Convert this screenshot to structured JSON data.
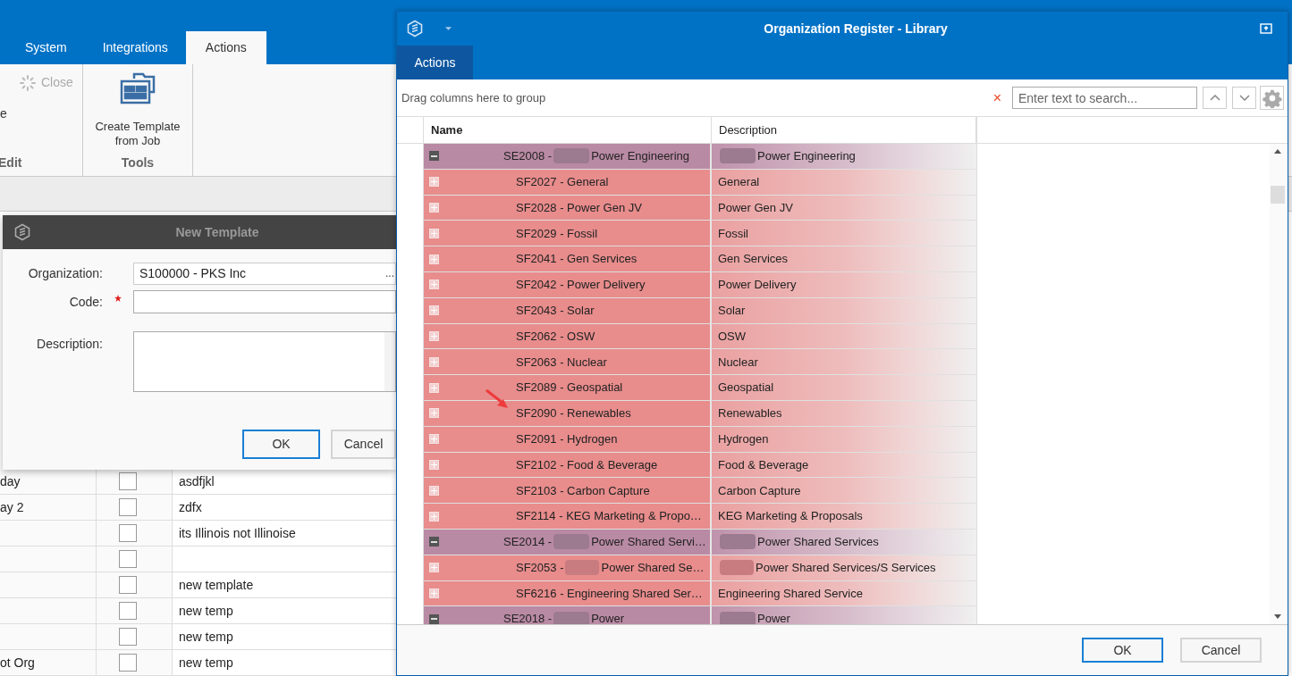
{
  "main_window": {
    "tabs": [
      {
        "label": "System",
        "selected": false
      },
      {
        "label": "Integrations",
        "selected": false
      },
      {
        "label": "Actions",
        "selected": true
      }
    ],
    "ribbon": {
      "groups": [
        {
          "label": "Edit",
          "partial_label": "e",
          "buttons": [
            {
              "label": "Close",
              "disabled": true
            }
          ]
        },
        {
          "label": "Tools",
          "buttons": [
            {
              "label": "Create Template from Job",
              "disabled": false
            }
          ]
        }
      ]
    },
    "grid": {
      "rows": [
        {
          "column_1": "day",
          "checked": false,
          "column_3": "asdfjkl"
        },
        {
          "column_1": "ay 2",
          "checked": false,
          "column_3": "zdfx"
        },
        {
          "checked": false,
          "column_3": "its Illinois not Illinoise"
        },
        {
          "checked": false
        },
        {
          "checked": false,
          "column_3": "new template"
        },
        {
          "checked": false,
          "column_3": "new temp"
        },
        {
          "checked": false,
          "column_3": "new temp"
        },
        {
          "column_1": "ot Org",
          "checked": false,
          "column_3": "new temp"
        }
      ]
    }
  },
  "new_template_dialog": {
    "title": "New Template",
    "organization": {
      "label": "Organization:",
      "value": "S100000 - PKS Inc",
      "ellipsis": "..."
    },
    "code": {
      "label": "Code:",
      "required": true
    },
    "description": {
      "label": "Description:"
    },
    "buttons": [
      {
        "label": "OK",
        "default": true
      },
      {
        "label": "Cancel",
        "default": false
      }
    ]
  },
  "library_dialog": {
    "title": "Organization Register - Library",
    "tab": "Actions",
    "group_hint": "Drag columns here to group",
    "clear_mark": "×",
    "search_placeholder": "Enter text to search...",
    "columns": [
      "Name",
      "Description"
    ],
    "rows": [
      {
        "kind": "group",
        "code": "SE2008 -",
        "name": "Power Engineering",
        "description": "Power Engineering",
        "redacted": true,
        "expanded": true,
        "children": [
          {
            "kind": "item",
            "code": "SF2027 -",
            "name": "General",
            "description": "General",
            "redacted": false,
            "expanded": false
          },
          {
            "kind": "item",
            "code": "SF2028 -",
            "name": "Power Gen JV",
            "description": "Power Gen JV",
            "redacted": false,
            "expanded": false
          },
          {
            "kind": "item",
            "code": "SF2029 -",
            "name": "Fossil",
            "description": "Fossil",
            "redacted": false,
            "expanded": false
          },
          {
            "kind": "item",
            "code": "SF2041 -",
            "name": "Gen Services",
            "description": "Gen Services",
            "redacted": false,
            "expanded": false
          },
          {
            "kind": "item",
            "code": "SF2042 -",
            "name": "Power Delivery",
            "description": "Power Delivery",
            "redacted": false,
            "expanded": false
          },
          {
            "kind": "item",
            "code": "SF2043 -",
            "name": "Solar",
            "description": "Solar",
            "redacted": false,
            "expanded": false
          },
          {
            "kind": "item",
            "code": "SF2062 -",
            "name": "OSW",
            "description": "OSW",
            "redacted": false,
            "expanded": false
          },
          {
            "kind": "item",
            "code": "SF2063 -",
            "name": "Nuclear",
            "description": "Nuclear",
            "redacted": false,
            "expanded": false
          },
          {
            "kind": "item",
            "code": "SF2089 -",
            "name": "Geospatial",
            "description": "Geospatial",
            "redacted": false,
            "expanded": false
          },
          {
            "kind": "item",
            "code": "SF2090 -",
            "name": "Renewables",
            "description": "Renewables",
            "redacted": false,
            "expanded": false
          },
          {
            "kind": "item",
            "code": "SF2091 -",
            "name": "Hydrogen",
            "description": "Hydrogen",
            "redacted": false,
            "expanded": false
          },
          {
            "kind": "item",
            "code": "SF2102 -",
            "name": "Food & Beverage",
            "description": "Food & Beverage",
            "redacted": false,
            "expanded": false
          },
          {
            "kind": "item",
            "code": "SF2103 -",
            "name": "Carbon Capture",
            "description": "Carbon Capture",
            "redacted": false,
            "expanded": false
          },
          {
            "kind": "item",
            "code": "SF2114 -",
            "name": "KEG Marketing & Propo…",
            "description": "KEG Marketing & Proposals",
            "redacted": false,
            "expanded": false
          }
        ]
      },
      {
        "kind": "group",
        "code": "SE2014 -",
        "name": "Power Shared Servi…",
        "description": "Power Shared Services",
        "redacted": true,
        "expanded": true,
        "children": [
          {
            "kind": "item",
            "code": "SF2053 -",
            "name": "Power Shared Se…",
            "description": "Power Shared Services/S Services",
            "redacted": true,
            "expanded": false
          },
          {
            "kind": "item",
            "code": "SF6216 -",
            "name": "Engineering Shared Ser…",
            "description": "Engineering Shared Service",
            "redacted": false,
            "expanded": false
          }
        ]
      },
      {
        "kind": "group",
        "code": "SE2018 -",
        "name": "Power",
        "description": "Power",
        "redacted": true,
        "expanded": true
      }
    ],
    "buttons": [
      {
        "label": "OK",
        "default": true
      },
      {
        "label": "Cancel",
        "default": false
      }
    ]
  }
}
